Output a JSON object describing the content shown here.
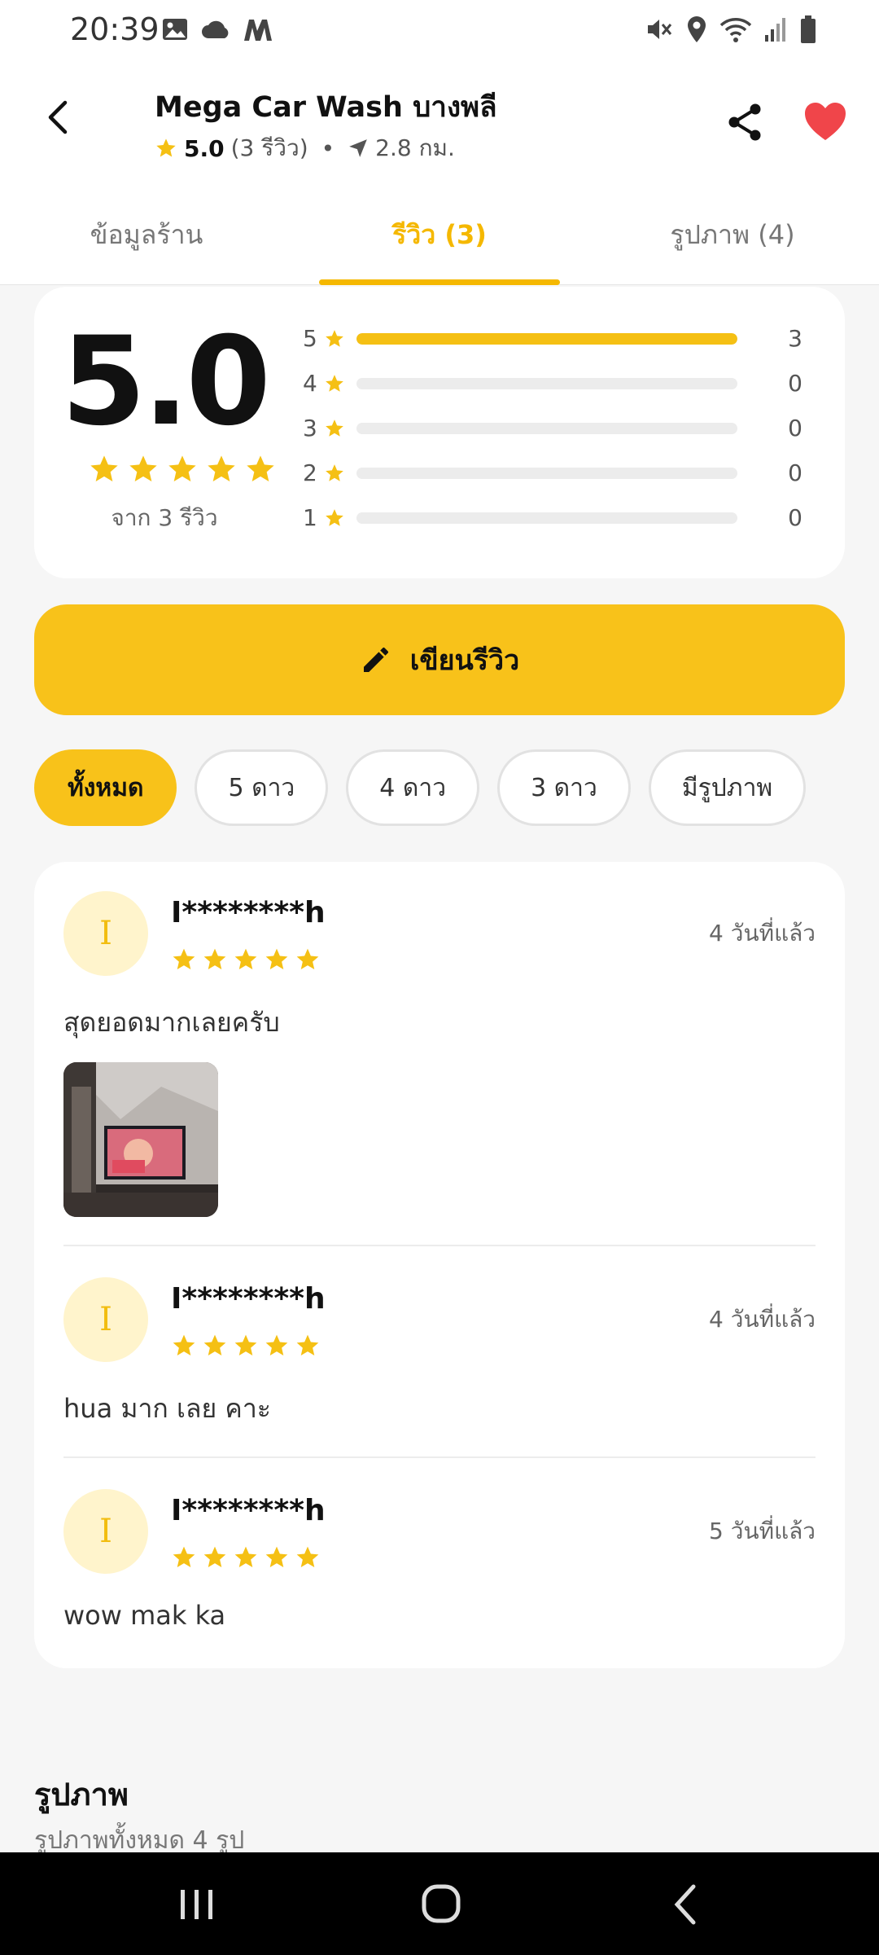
{
  "status_bar": {
    "time": "20:39",
    "left_icons": [
      "image-icon",
      "cloud-icon",
      "m-app-icon"
    ],
    "right_icons": [
      "mute-icon",
      "location-icon",
      "wifi-icon",
      "signal-icon",
      "battery-icon"
    ]
  },
  "header": {
    "title": "Mega Car Wash บางพลี",
    "rating": "5.0",
    "review_count": "(3 รีวิว)",
    "separator": "•",
    "distance": "2.8 กม."
  },
  "tabs": [
    {
      "label": "ข้อมูลร้าน",
      "active": false
    },
    {
      "label": "รีวิว (3)",
      "active": true
    },
    {
      "label": "รูปภาพ (4)",
      "active": false
    }
  ],
  "summary": {
    "score": "5.0",
    "stars": 5,
    "from_text": "จาก 3 รีวิว",
    "distribution": [
      {
        "stars": "5",
        "count": "3",
        "fraction": 1.0
      },
      {
        "stars": "4",
        "count": "0",
        "fraction": 0
      },
      {
        "stars": "3",
        "count": "0",
        "fraction": 0
      },
      {
        "stars": "2",
        "count": "0",
        "fraction": 0
      },
      {
        "stars": "1",
        "count": "0",
        "fraction": 0
      }
    ]
  },
  "write_review": {
    "label": "เขียนรีวิว"
  },
  "filters": [
    {
      "label": "ทั้งหมด",
      "active": true
    },
    {
      "label": "5 ดาว",
      "active": false
    },
    {
      "label": "4 ดาว",
      "active": false
    },
    {
      "label": "3 ดาว",
      "active": false
    },
    {
      "label": "มีรูปภาพ",
      "active": false
    }
  ],
  "reviews": [
    {
      "initial": "I",
      "name": "I********h",
      "stars": 5,
      "time": "4 วันที่แล้ว",
      "text": "สุดยอดมากเลยครับ",
      "has_photo": true
    },
    {
      "initial": "I",
      "name": "I********h",
      "stars": 5,
      "time": "4 วันที่แล้ว",
      "text": "hua มาก เลย คาะ",
      "has_photo": false
    },
    {
      "initial": "I",
      "name": "I********h",
      "stars": 5,
      "time": "5 วันที่แล้ว",
      "text": "wow mak ka",
      "has_photo": false
    }
  ],
  "photos_section": {
    "title": "รูปภาพ",
    "subtitle": "รูปภาพทั้งหมด 4 รูป"
  },
  "colors": {
    "accent": "#f8c21a",
    "star": "#f5c014",
    "heart": "#f0454a"
  }
}
